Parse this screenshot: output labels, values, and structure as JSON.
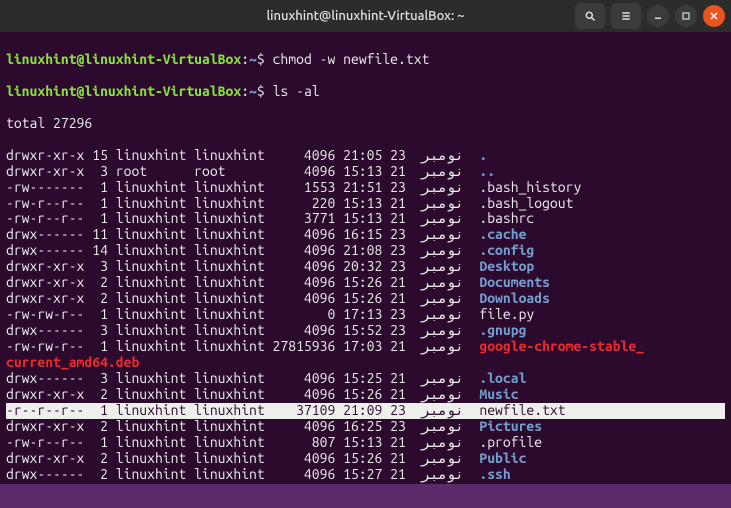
{
  "window": {
    "title": "linuxhint@linuxhint-VirtualBox: ~"
  },
  "prompt": {
    "user_host": "linuxhint@linuxhint-VirtualBox",
    "sep": ":",
    "path": "~",
    "dollar": "$ "
  },
  "commands": {
    "cmd1": "chmod -w newfile.txt",
    "cmd2": "ls -al"
  },
  "total_line": "total 27296",
  "header_btns": {
    "search": "search",
    "menu": "menu",
    "min": "min",
    "max": "max",
    "close": "close"
  },
  "rows": [
    {
      "perm": "drwxr-xr-x",
      "links": "15",
      "owner": "linuxhint",
      "group": "linuxhint",
      "size": "4096",
      "time": "21:05",
      "day": "23",
      "month": "نومبر",
      "name": ".",
      "cls": "blue"
    },
    {
      "perm": "drwxr-xr-x",
      "links": "3",
      "owner": "root",
      "group": "root",
      "size": "4096",
      "time": "15:13",
      "day": "21",
      "month": "نومبر",
      "name": "..",
      "cls": "blue"
    },
    {
      "perm": "-rw-------",
      "links": "1",
      "owner": "linuxhint",
      "group": "linuxhint",
      "size": "1553",
      "time": "21:51",
      "day": "23",
      "month": "نومبر",
      "name": ".bash_history",
      "cls": "white"
    },
    {
      "perm": "-rw-r--r--",
      "links": "1",
      "owner": "linuxhint",
      "group": "linuxhint",
      "size": "220",
      "time": "15:13",
      "day": "21",
      "month": "نومبر",
      "name": ".bash_logout",
      "cls": "white"
    },
    {
      "perm": "-rw-r--r--",
      "links": "1",
      "owner": "linuxhint",
      "group": "linuxhint",
      "size": "3771",
      "time": "15:13",
      "day": "21",
      "month": "نومبر",
      "name": ".bashrc",
      "cls": "white"
    },
    {
      "perm": "drwx------",
      "links": "11",
      "owner": "linuxhint",
      "group": "linuxhint",
      "size": "4096",
      "time": "16:15",
      "day": "23",
      "month": "نومبر",
      "name": ".cache",
      "cls": "blue"
    },
    {
      "perm": "drwx------",
      "links": "14",
      "owner": "linuxhint",
      "group": "linuxhint",
      "size": "4096",
      "time": "21:08",
      "day": "23",
      "month": "نومبر",
      "name": ".config",
      "cls": "blue"
    },
    {
      "perm": "drwxr-xr-x",
      "links": "3",
      "owner": "linuxhint",
      "group": "linuxhint",
      "size": "4096",
      "time": "20:32",
      "day": "23",
      "month": "نومبر",
      "name": "Desktop",
      "cls": "blue"
    },
    {
      "perm": "drwxr-xr-x",
      "links": "2",
      "owner": "linuxhint",
      "group": "linuxhint",
      "size": "4096",
      "time": "15:26",
      "day": "21",
      "month": "نومبر",
      "name": "Documents",
      "cls": "blue"
    },
    {
      "perm": "drwxr-xr-x",
      "links": "2",
      "owner": "linuxhint",
      "group": "linuxhint",
      "size": "4096",
      "time": "15:26",
      "day": "21",
      "month": "نومبر",
      "name": "Downloads",
      "cls": "blue"
    },
    {
      "perm": "-rw-rw-r--",
      "links": "1",
      "owner": "linuxhint",
      "group": "linuxhint",
      "size": "0",
      "time": "17:13",
      "day": "23",
      "month": "نومبر",
      "name": "file.py",
      "cls": "white"
    },
    {
      "perm": "drwx------",
      "links": "3",
      "owner": "linuxhint",
      "group": "linuxhint",
      "size": "4096",
      "time": "15:52",
      "day": "23",
      "month": "نومبر",
      "name": ".gnupg",
      "cls": "blue"
    },
    {
      "perm": "-rw-rw-r--",
      "links": "1",
      "owner": "linuxhint",
      "group": "linuxhint",
      "size": "27815936",
      "time": "17:03",
      "day": "21",
      "month": "نومبر",
      "name": "google-chrome-stable_",
      "cls": "red",
      "wrap": "current_amd64.deb"
    },
    {
      "perm": "drwx------",
      "links": "3",
      "owner": "linuxhint",
      "group": "linuxhint",
      "size": "4096",
      "time": "15:25",
      "day": "21",
      "month": "نومبر",
      "name": ".local",
      "cls": "blue"
    },
    {
      "perm": "drwxr-xr-x",
      "links": "2",
      "owner": "linuxhint",
      "group": "linuxhint",
      "size": "4096",
      "time": "15:26",
      "day": "21",
      "month": "نومبر",
      "name": "Music",
      "cls": "blue"
    },
    {
      "perm": "-r--r--r--",
      "links": "1",
      "owner": "linuxhint",
      "group": "linuxhint",
      "size": "37109",
      "time": "21:09",
      "day": "23",
      "month": "نومبر",
      "name": "newfile.txt",
      "cls": "hl"
    },
    {
      "perm": "drwxr-xr-x",
      "links": "2",
      "owner": "linuxhint",
      "group": "linuxhint",
      "size": "4096",
      "time": "16:25",
      "day": "23",
      "month": "نومبر",
      "name": "Pictures",
      "cls": "blue"
    },
    {
      "perm": "-rw-r--r--",
      "links": "1",
      "owner": "linuxhint",
      "group": "linuxhint",
      "size": "807",
      "time": "15:13",
      "day": "21",
      "month": "نومبر",
      "name": ".profile",
      "cls": "white"
    },
    {
      "perm": "drwxr-xr-x",
      "links": "2",
      "owner": "linuxhint",
      "group": "linuxhint",
      "size": "4096",
      "time": "15:26",
      "day": "21",
      "month": "نومبر",
      "name": "Public",
      "cls": "blue"
    },
    {
      "perm": "drwx------",
      "links": "2",
      "owner": "linuxhint",
      "group": "linuxhint",
      "size": "4096",
      "time": "15:27",
      "day": "21",
      "month": "نومبر",
      "name": ".ssh",
      "cls": "blue"
    }
  ]
}
